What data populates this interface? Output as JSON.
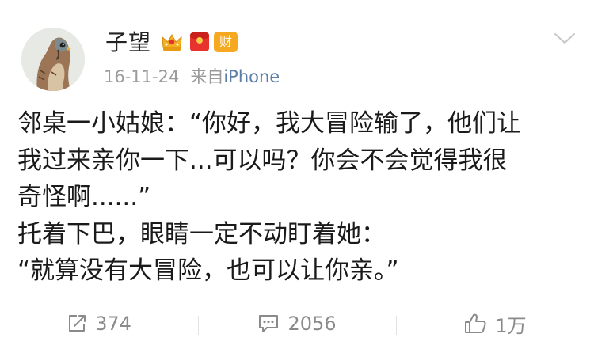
{
  "author": {
    "name": "子望",
    "avatar_icon": "kestrel-avatar",
    "badges": [
      "crown-badge-icon",
      "red-packet-badge-icon"
    ],
    "wealth_badge_label": "财"
  },
  "meta": {
    "date": "16-11-24",
    "source_prefix": "来自",
    "source_name": "iPhone"
  },
  "post": {
    "lines": [
      "邻桌一小姑娘：“你好，我大冒险输了，他们让",
      "我过来亲你一下...可以吗？你会不会觉得我很",
      "奇怪啊......”",
      "托着下巴，眼睛一定不动盯着她：",
      "“就算没有大冒险，也可以让你亲。”"
    ]
  },
  "actions": {
    "repost_count": "374",
    "comment_count": "2056",
    "like_count": "1万"
  },
  "colors": {
    "meta_gray": "#9b9b9b",
    "link_blue": "#5b7fa8",
    "action_gray": "#8a8a8a",
    "wealth_badge": "#f6a821",
    "red_packet": "#e8322d"
  }
}
